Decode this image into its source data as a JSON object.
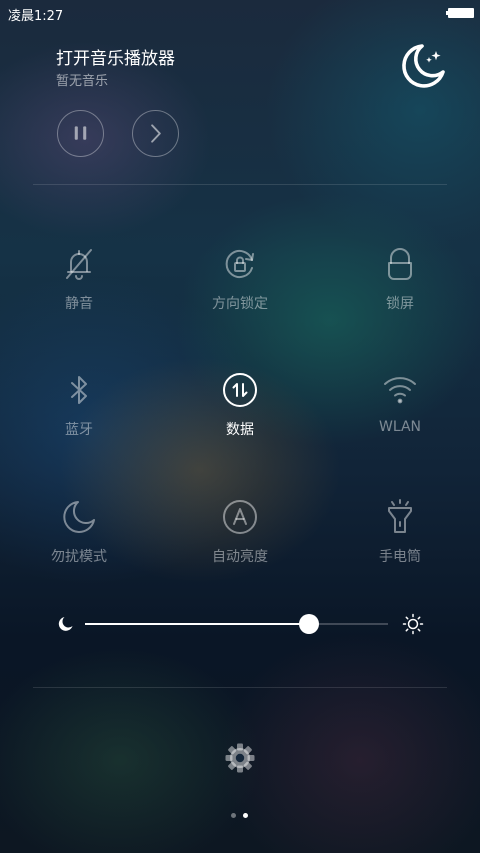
{
  "status_bar": {
    "time": "凌晨1:27",
    "battery_icon": "battery-full-icon"
  },
  "music": {
    "title": "打开音乐播放器",
    "subtitle": "暂无音乐",
    "night_mode_icon": "moon-stars-icon",
    "controls": [
      {
        "name": "pause",
        "icon": "pause-icon"
      },
      {
        "name": "next",
        "icon": "chevron-right-icon"
      }
    ]
  },
  "toggles": [
    {
      "label": "静音",
      "icon": "bell-mute-icon",
      "active": false
    },
    {
      "label": "方向锁定",
      "icon": "rotation-lock-icon",
      "active": false
    },
    {
      "label": "锁屏",
      "icon": "lock-icon",
      "active": false
    },
    {
      "label": "蓝牙",
      "icon": "bluetooth-icon",
      "active": false
    },
    {
      "label": "数据",
      "icon": "data-icon",
      "active": true
    },
    {
      "label": "WLAN",
      "icon": "wifi-icon",
      "active": false
    },
    {
      "label": "勿扰模式",
      "icon": "moon-icon",
      "active": false
    },
    {
      "label": "自动亮度",
      "icon": "auto-brightness-icon",
      "active": false
    },
    {
      "label": "手电筒",
      "icon": "flashlight-icon",
      "active": false
    }
  ],
  "brightness": {
    "level": 0.74,
    "min_icon": "moon-icon",
    "max_icon": "sun-icon"
  },
  "settings_icon": "gear-icon",
  "pager": {
    "count": 2,
    "current": 2
  },
  "colors": {
    "active": "#ffffff",
    "inactive": "rgba(255,255,255,0.45)"
  }
}
